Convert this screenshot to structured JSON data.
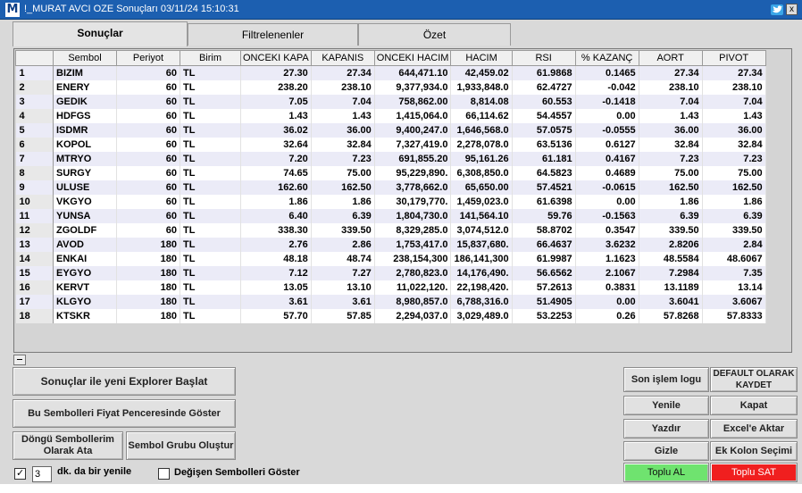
{
  "window": {
    "logo_letter": "M",
    "title": "!_MURAT AVCI  OZE Sonuçları  03/11/24 15:10:31",
    "close_glyph": "x"
  },
  "tabs": [
    {
      "label": "Sonuçlar",
      "active": true
    },
    {
      "label": "Filtrelenenler",
      "active": false
    },
    {
      "label": "Özet",
      "active": false
    }
  ],
  "table": {
    "columns": [
      "",
      "Sembol",
      "Periyot",
      "Birim",
      "ONCEKI KAPA",
      "KAPANIS",
      "ONCEKI HACIM",
      "HACIM",
      "RSI",
      "% KAZANÇ",
      "AORT",
      "PIVOT"
    ],
    "rows": [
      [
        "1",
        "BIZIM",
        "60",
        "TL",
        "27.30",
        "27.34",
        "644,471.10",
        "42,459.02",
        "61.9868",
        "0.1465",
        "27.34",
        "27.34"
      ],
      [
        "2",
        "ENERY",
        "60",
        "TL",
        "238.20",
        "238.10",
        "9,377,934.0",
        "1,933,848.0",
        "62.4727",
        "-0.042",
        "238.10",
        "238.10"
      ],
      [
        "3",
        "GEDIK",
        "60",
        "TL",
        "7.05",
        "7.04",
        "758,862.00",
        "8,814.08",
        "60.553",
        "-0.1418",
        "7.04",
        "7.04"
      ],
      [
        "4",
        "HDFGS",
        "60",
        "TL",
        "1.43",
        "1.43",
        "1,415,064.0",
        "66,114.62",
        "54.4557",
        "0.00",
        "1.43",
        "1.43"
      ],
      [
        "5",
        "ISDMR",
        "60",
        "TL",
        "36.02",
        "36.00",
        "9,400,247.0",
        "1,646,568.0",
        "57.0575",
        "-0.0555",
        "36.00",
        "36.00"
      ],
      [
        "6",
        "KOPOL",
        "60",
        "TL",
        "32.64",
        "32.84",
        "7,327,419.0",
        "2,278,078.0",
        "63.5136",
        "0.6127",
        "32.84",
        "32.84"
      ],
      [
        "7",
        "MTRYO",
        "60",
        "TL",
        "7.20",
        "7.23",
        "691,855.20",
        "95,161.26",
        "61.181",
        "0.4167",
        "7.23",
        "7.23"
      ],
      [
        "8",
        "SURGY",
        "60",
        "TL",
        "74.65",
        "75.00",
        "95,229,890.",
        "6,308,850.0",
        "64.5823",
        "0.4689",
        "75.00",
        "75.00"
      ],
      [
        "9",
        "ULUSE",
        "60",
        "TL",
        "162.60",
        "162.50",
        "3,778,662.0",
        "65,650.00",
        "57.4521",
        "-0.0615",
        "162.50",
        "162.50"
      ],
      [
        "10",
        "VKGYO",
        "60",
        "TL",
        "1.86",
        "1.86",
        "30,179,770.",
        "1,459,023.0",
        "61.6398",
        "0.00",
        "1.86",
        "1.86"
      ],
      [
        "11",
        "YUNSA",
        "60",
        "TL",
        "6.40",
        "6.39",
        "1,804,730.0",
        "141,564.10",
        "59.76",
        "-0.1563",
        "6.39",
        "6.39"
      ],
      [
        "12",
        "ZGOLDF",
        "60",
        "TL",
        "338.30",
        "339.50",
        "8,329,285.0",
        "3,074,512.0",
        "58.8702",
        "0.3547",
        "339.50",
        "339.50"
      ],
      [
        "13",
        "AVOD",
        "180",
        "TL",
        "2.76",
        "2.86",
        "1,753,417.0",
        "15,837,680.",
        "66.4637",
        "3.6232",
        "2.8206",
        "2.84"
      ],
      [
        "14",
        "ENKAI",
        "180",
        "TL",
        "48.18",
        "48.74",
        "238,154,300",
        "186,141,300",
        "61.9987",
        "1.1623",
        "48.5584",
        "48.6067"
      ],
      [
        "15",
        "EYGYO",
        "180",
        "TL",
        "7.12",
        "7.27",
        "2,780,823.0",
        "14,176,490.",
        "56.6562",
        "2.1067",
        "7.2984",
        "7.35"
      ],
      [
        "16",
        "KERVT",
        "180",
        "TL",
        "13.05",
        "13.10",
        "11,022,120.",
        "22,198,420.",
        "57.2613",
        "0.3831",
        "13.1189",
        "13.14"
      ],
      [
        "17",
        "KLGYO",
        "180",
        "TL",
        "3.61",
        "3.61",
        "8,980,857.0",
        "6,788,316.0",
        "51.4905",
        "0.00",
        "3.6041",
        "3.6067"
      ],
      [
        "18",
        "KTSKR",
        "180",
        "TL",
        "57.70",
        "57.85",
        "2,294,037.0",
        "3,029,489.0",
        "53.2253",
        "0.26",
        "57.8268",
        "57.8333"
      ]
    ]
  },
  "left_buttons": {
    "explorer": "Sonuçlar ile yeni Explorer Başlat",
    "fiyat": "Bu Sembolleri Fiyat Penceresinde Göster",
    "dongu": "Döngü Sembollerim Olarak Ata",
    "grup": "Sembol Grubu Oluştur"
  },
  "refresh": {
    "checked": true,
    "minutes": "3",
    "label": "dk. da bir yenile"
  },
  "changed_symbols": {
    "checked": false,
    "label": "Değişen Sembolleri Göster"
  },
  "right_buttons": {
    "son_islem": "Son işlem logu",
    "default": "DEFAULT OLARAK KAYDET",
    "yenile": "Yenile",
    "kapat": "Kapat",
    "yazdir": "Yazdır",
    "excel": "Excel'e Aktar",
    "gizle": "Gizle",
    "ek_kolon": "Ek Kolon Seçimi",
    "toplu_al": "Toplu AL",
    "toplu_sat": "Toplu SAT"
  },
  "colors": {
    "titlebar": "#1c5fb0",
    "buy": "#6fe36f",
    "sell": "#f01f1f",
    "row_alt": "#ebebf7"
  }
}
